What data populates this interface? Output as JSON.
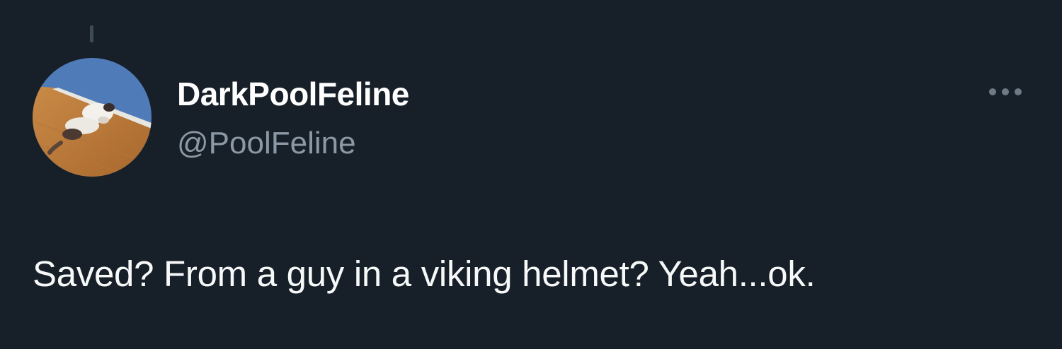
{
  "tweet": {
    "display_name": "DarkPoolFeline",
    "handle": "@PoolFeline",
    "text": "Saved? From a guy in a viking helmet? Yeah...ok.",
    "avatar_icon": "cat-on-floor-avatar",
    "more_icon": "more-options-icon"
  },
  "colors": {
    "background": "#172029",
    "name": "#ffffff",
    "handle": "#8b98a5",
    "text": "#f7f9f9"
  }
}
